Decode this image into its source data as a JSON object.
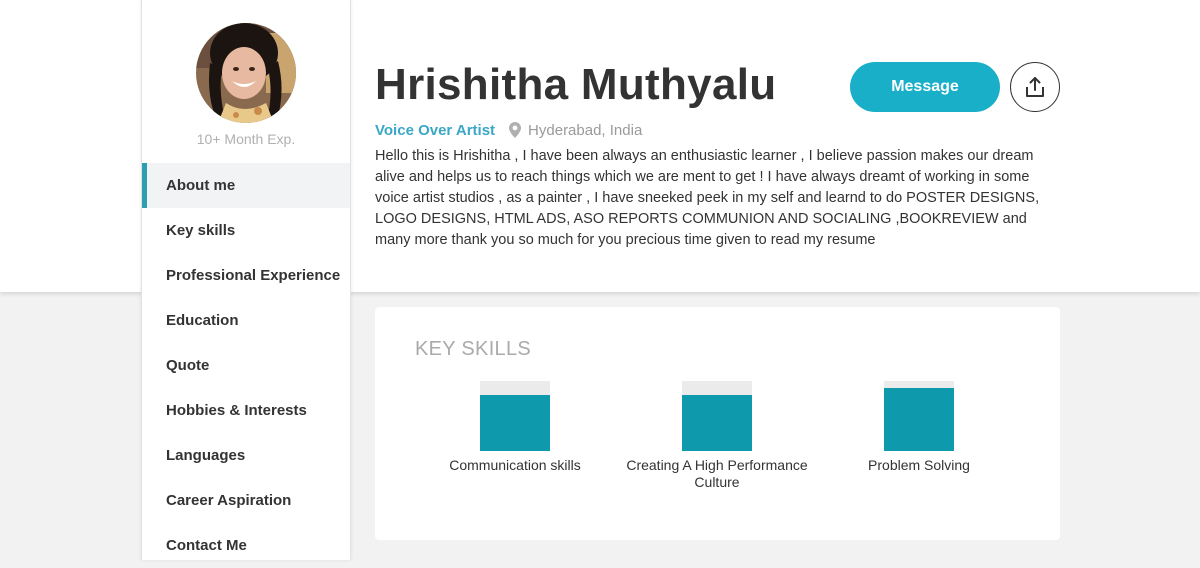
{
  "profile": {
    "name": "Hrishitha Muthyalu",
    "role": "Voice Over Artist",
    "location": "Hyderabad, India",
    "experience": "10+ Month Exp.",
    "bio": "Hello this is Hrishitha , I have been always an enthusiastic learner , I believe passion makes our dream alive and helps us to reach things which we are ment to get ! I have always dreamt of working in some voice artist studios , as a painter , I have sneeked peek in my self and learnd to do POSTER DESIGNS, LOGO DESIGNS, HTML ADS, ASO REPORTS COMMUNION AND SOCIALING ,BOOKREVIEW and many more thank you so much for you precious time given to read my resume"
  },
  "actions": {
    "message_label": "Message",
    "share_icon": "share-upload-icon"
  },
  "sidebar": {
    "items": [
      {
        "label": "About me",
        "active": true
      },
      {
        "label": "Key skills"
      },
      {
        "label": "Professional Experience"
      },
      {
        "label": "Education"
      },
      {
        "label": "Quote"
      },
      {
        "label": "Hobbies & Interests"
      },
      {
        "label": "Languages"
      },
      {
        "label": "Career Aspiration"
      },
      {
        "label": "Contact Me"
      }
    ]
  },
  "skills": {
    "title": "KEY SKILLS",
    "items": [
      {
        "label": "Communication skills",
        "level": 0.8
      },
      {
        "label": "Creating A High Performance Culture",
        "level": 0.8
      },
      {
        "label": "Problem Solving",
        "level": 0.9
      }
    ]
  },
  "colors": {
    "accent": "#1aafc9",
    "active_border": "#2c9fb3",
    "skill_fill": "#0e99ad",
    "role_text": "#3aa7c7"
  }
}
